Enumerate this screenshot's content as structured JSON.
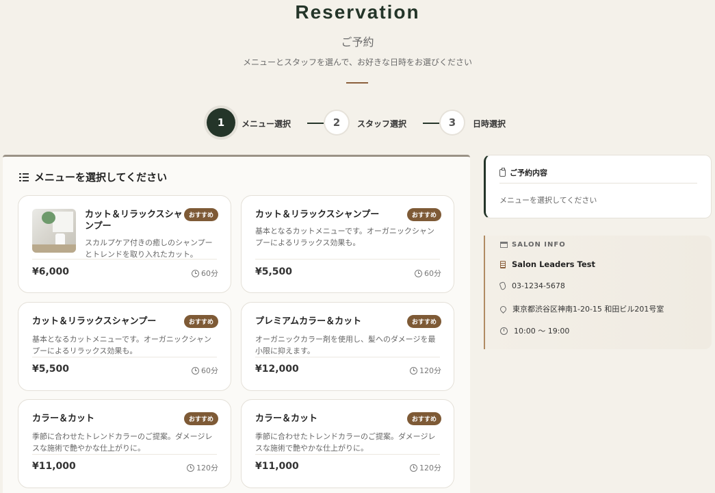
{
  "header": {
    "title": "Reservation",
    "subtitle": "ご予約",
    "lead": "メニューとスタッフを選んで、お好きな日時をお選びください"
  },
  "stepper": [
    {
      "number": "1",
      "label": "メニュー選択",
      "state": "active"
    },
    {
      "number": "2",
      "label": "スタッフ選択",
      "state": "inactive"
    },
    {
      "number": "3",
      "label": "日時選択",
      "state": "inactive"
    }
  ],
  "menu_panel": {
    "title": "メニューを選択してください",
    "cards": [
      {
        "name": "カット＆リラックスシャンプー",
        "badge": "おすすめ",
        "desc": "スカルプケア付きの癒しのシャンプーとトレンドを取り入れたカット。",
        "price": "¥6,000",
        "duration": "60分",
        "has_image": true
      },
      {
        "name": "カット＆リラックスシャンプー",
        "badge": "おすすめ",
        "desc": "基本となるカットメニューです。オーガニックシャンプーによるリラックス効果も。",
        "price": "¥5,500",
        "duration": "60分",
        "has_image": false
      },
      {
        "name": "カット＆リラックスシャンプー",
        "badge": "おすすめ",
        "desc": "基本となるカットメニューです。オーガニックシャンプーによるリラックス効果も。",
        "price": "¥5,500",
        "duration": "60分",
        "has_image": false
      },
      {
        "name": "プレミアムカラー＆カット",
        "badge": "おすすめ",
        "desc": "オーガニックカラー剤を使用し、髪へのダメージを最小限に抑えます。",
        "price": "¥12,000",
        "duration": "120分",
        "has_image": false
      },
      {
        "name": "カラー＆カット",
        "badge": "おすすめ",
        "desc": "季節に合わせたトレンドカラーのご提案。ダメージレスな施術で艶やかな仕上がりに。",
        "price": "¥11,000",
        "duration": "120分",
        "has_image": false
      },
      {
        "name": "カラー＆カット",
        "badge": "おすすめ",
        "desc": "季節に合わせたトレンドカラーのご提案。ダメージレスな施術で艶やかな仕上がりに。",
        "price": "¥11,000",
        "duration": "120分",
        "has_image": false
      }
    ]
  },
  "summary": {
    "title": "ご予約内容",
    "empty_text": "メニューを選択してください"
  },
  "salon_info": {
    "heading": "SALON INFO",
    "name": "Salon Leaders Test",
    "phone": "03-1234-5678",
    "address": "東京都渋谷区神南1-20-15 和田ビル201号室",
    "hours": "10:00 〜 19:00"
  },
  "colors": {
    "primary": "#243529",
    "accent": "#7e5a36",
    "background": "#f4f1ea"
  }
}
